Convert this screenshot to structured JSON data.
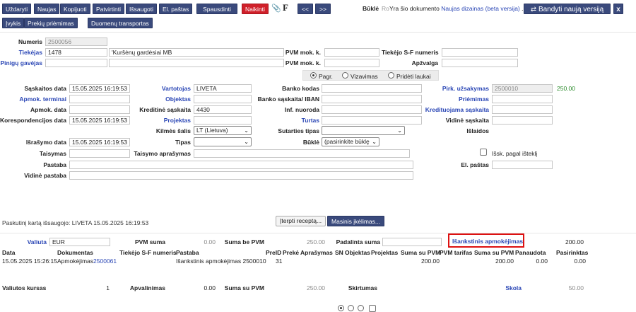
{
  "toolbar": {
    "buttons": [
      "Uždaryti",
      "Naujas",
      "Kopijuoti",
      "Patvirtinti",
      "Išsaugoti",
      "El. paštas",
      "Spausdinti",
      "Naikinti"
    ],
    "attach_icon": "paperclip-icon",
    "f_label": "F",
    "prev": "<<",
    "next": ">>",
    "bukle_label": "Būklė",
    "bukle_value": "Ro",
    "info_prefix": "Yra šio dokumento",
    "info_link": "Naujas dizainas (beta versija)",
    "info_suffix": ".",
    "new_version_label": "⇄ Bandyti naują versiją",
    "close_label": "x"
  },
  "subtoolbar": [
    "Įvykis",
    "Prekių priėmimas",
    "Duomenų transportas"
  ],
  "header": {
    "numeris_label": "Numeris",
    "numeris": "2500056",
    "tiekejas_label": "Tiekėjas",
    "tiekejas_code": "1478",
    "tiekejas_name": "'Kuršėnų gardėsiai MB",
    "pvm_mok_k_label": "PVM mok. k.",
    "tiekejo_sf_label": "Tiekėjo S-F numeris",
    "piniginis_label": "Pinigų gavėjas",
    "pvm_mok_k2_label": "PVM mok. k.",
    "apzvalga_label": "Apžvalga"
  },
  "tabs": {
    "pagr": "Pagr.",
    "vizavimas": "Vizavimas",
    "prideti": "Pridėti laukai"
  },
  "form": {
    "saskaitos_data_label": "Sąskaitos data",
    "saskaitos_data": "15.05.2025 16:19:53",
    "vartotojas_label": "Vartotojas",
    "vartotojas": "LIVETA",
    "banko_kodas_label": "Banko kodas",
    "pirk_uzsakymas_label": "Pirk. užsakymas",
    "pirk_uzsakymas": "2500010",
    "pirk_amount": "250.00",
    "apmok_terminai_label": "Apmok. terminai",
    "objektas_label": "Objektas",
    "banko_iban_label": "Banko sąskaita/ IBAN",
    "priemimas_label": "Priėmimas",
    "apmok_data_label": "Apmok. data",
    "kreditine_label": "Kreditinė sąskaita",
    "kreditine": "4430",
    "inf_nuoroda_label": "Inf. nuoroda",
    "kredituojama_label": "Kredituojama sąskaita",
    "koresp_label": "Korespondencijos data",
    "koresp": "15.05.2025 16:19:53",
    "projektas_label": "Projektas",
    "turtas_label": "Turtas",
    "vidine_sask_label": "Vidinė sąskaita",
    "kilmes_label": "Kilmės šalis",
    "kilmes": "LT (Lietuva)",
    "sutarties_label": "Sutarties tipas",
    "islaidos_label": "Išlaidos",
    "israsymo_label": "Išrašymo data",
    "israsymo": "15.05.2025 16:19:53",
    "tipas_label": "Tipas",
    "bukle_label": "Būklė",
    "bukle_select": "(pasirinkite būklę",
    "taisymas_label": "Taisymas",
    "taisymo_apr_label": "Taisymo aprašymas",
    "issk_label": "Išsk. pagal išteklį",
    "pastaba_label": "Pastaba",
    "el_pastas_label": "El. paštas",
    "vidine_pastaba_label": "Vidinė pastaba"
  },
  "saved_info": "Paskutinį kartą išsaugojo: LIVETA 15.05.2025 16:19:53",
  "iterpti_label": "Įterpti receptą...",
  "masinis_label": "Masinis įkėlimas...",
  "totals": {
    "valiuta_label": "Valiuta",
    "valiuta": "EUR",
    "pvm_suma_label": "PVM suma",
    "pvm_suma": "0.00",
    "suma_be_pvm_label": "Suma be PVM",
    "suma_be_pvm": "250.00",
    "padalinta_label": "Padalinta suma",
    "isankstinis_label": "Išankstinis apmokėjimas",
    "isankstinis": "200.00"
  },
  "table": {
    "headers": [
      "Data",
      "Dokumentas",
      "Tiekėjo S-F numeris",
      "Pastaba",
      "PreID",
      "Prekė",
      "Aprašymas",
      "SN",
      "Objektas",
      "Projektas",
      "Suma su PVM",
      "PVM tarifas",
      "Suma su PVM",
      "Panaudota",
      "Pasirinktas"
    ],
    "row": {
      "data": "15.05.2025 15:26:15",
      "dok_prefix": "Apmokėjimas",
      "dok_link": "2500061",
      "pastaba": "Išankstinis apmokėjimas 2500010",
      "preid": "31",
      "suma1": "200.00",
      "suma2": "200.00",
      "panaudota": "0.00",
      "pasirinktas": "0.00"
    }
  },
  "footer": {
    "valiutos_kursas_label": "Valiutos kursas",
    "valiutos_kursas": "1",
    "apvalinimas_label": "Apvalinimas",
    "apvalinimas": "0.00",
    "suma_su_pvm_label": "Suma su PVM",
    "suma_su_pvm": "250.00",
    "skirtumas_label": "Skirtumas",
    "skola_label": "Skola",
    "skola": "50.00"
  },
  "colors": {
    "button": "#3a4a7c",
    "danger": "#d0202a",
    "link": "#2a46b5",
    "highlight": "#d11111",
    "green": "#2a8a2a"
  }
}
